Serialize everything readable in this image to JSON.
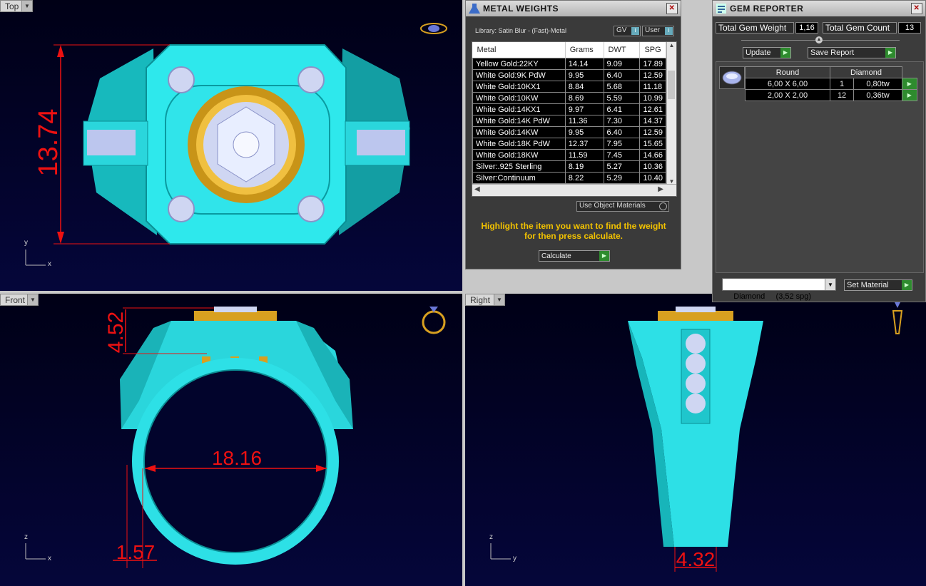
{
  "viewports": {
    "top": {
      "label": "Top",
      "axis_v": "y",
      "axis_h": "x"
    },
    "front": {
      "label": "Front",
      "axis_v": "z",
      "axis_h": "x"
    },
    "right": {
      "label": "Right",
      "axis_v": "z",
      "axis_h": "y"
    }
  },
  "dimensions": {
    "top_height": "13.74",
    "front_top": "4.52",
    "front_inner": "18.16",
    "front_band": "1.57",
    "right_band": "4.32"
  },
  "metal_weights": {
    "title": "METAL WEIGHTS",
    "library": "Library: Satin Blur - (Fast)-Metal",
    "gv_label": "GV",
    "user_label": "User",
    "columns": [
      "Metal",
      "Grams",
      "DWT",
      "SPG"
    ],
    "rows": [
      [
        "Yellow Gold:22KY",
        "14.14",
        "9.09",
        "17.89"
      ],
      [
        "White Gold:9K PdW",
        "9.95",
        "6.40",
        "12.59"
      ],
      [
        "White Gold:10KX1",
        "8.84",
        "5.68",
        "11.18"
      ],
      [
        "White Gold:10KW",
        "8.69",
        "5.59",
        "10.99"
      ],
      [
        "White Gold:14KX1",
        "9.97",
        "6.41",
        "12.61"
      ],
      [
        "White Gold:14K PdW",
        "11.36",
        "7.30",
        "14.37"
      ],
      [
        "White Gold:14KW",
        "9.95",
        "6.40",
        "12.59"
      ],
      [
        "White Gold:18K PdW",
        "12.37",
        "7.95",
        "15.65"
      ],
      [
        "White Gold:18KW",
        "11.59",
        "7.45",
        "14.66"
      ],
      [
        "Silver:.925 Sterling",
        "8.19",
        "5.27",
        "10.36"
      ],
      [
        "Silver:Continuum",
        "8.22",
        "5.29",
        "10.40"
      ]
    ],
    "use_object_materials": "Use Object Materials",
    "hint": "Highlight the item you want to find the weight for then press calculate.",
    "calculate": "Calculate"
  },
  "gem_reporter": {
    "title": "GEM REPORTER",
    "total_weight_label": "Total Gem Weight",
    "total_weight_value": "1,16",
    "total_count_label": "Total Gem Count",
    "total_count_value": "13",
    "update": "Update",
    "save_report": "Save Report",
    "table_headers": [
      "Round",
      "Diamond"
    ],
    "rows": [
      [
        "6,00 X 6,00",
        "1",
        "0,80tw"
      ],
      [
        "2,00 X 2,00",
        "12",
        "0,36tw"
      ]
    ],
    "material_select": "Diamond     (3,52 spg)",
    "set_material": "Set Material"
  },
  "colors": {
    "viewport_bg": "#02032a",
    "ring_metal": "#22e8e8",
    "gold": "#d8a020",
    "dimension": "#ee1111"
  }
}
